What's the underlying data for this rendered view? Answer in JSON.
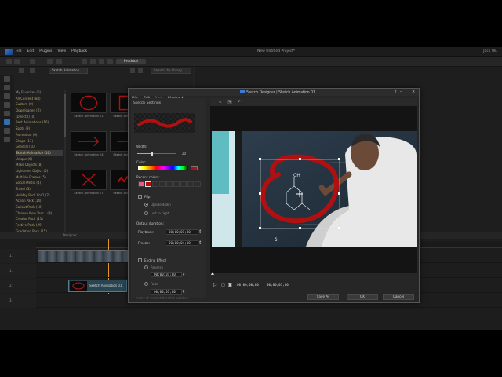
{
  "app": {
    "menu": [
      "File",
      "Edit",
      "Plugins",
      "View",
      "Playback"
    ],
    "project_title": "New Untitled Project*",
    "user": "Jack Wu",
    "produce_label": "Produce"
  },
  "library": {
    "dropdown_value": "Sketch Animation",
    "search_placeholder": "Search the library",
    "categories": [
      {
        "label": "My Favorites (0)",
        "type": "fav"
      },
      {
        "label": "All Content (84)"
      },
      {
        "label": "Custom (0)"
      },
      {
        "label": "Downloaded (0)"
      },
      {
        "label": "(DirectX) (0)"
      },
      {
        "label": "Best Animations (16)"
      },
      {
        "label": "Spots (9)"
      },
      {
        "label": "Animation (6)"
      },
      {
        "label": "Shape (17)"
      },
      {
        "label": "General (10)"
      },
      {
        "label": "Sketch Animation (16)",
        "type": "sel"
      },
      {
        "label": "Unique (6)"
      },
      {
        "label": "Make Objects (8)"
      },
      {
        "label": "Lightened Object (5)"
      },
      {
        "label": "Multiple Frames (5)"
      },
      {
        "label": "Social Media (4)"
      },
      {
        "label": "Travel (3)"
      },
      {
        "label": "Holiday Pack Vol 1 (7)"
      },
      {
        "label": "Action Pack (14)"
      },
      {
        "label": "Callout Pack (10)"
      },
      {
        "label": "Chinese New Year... (9)"
      },
      {
        "label": "Creator Pack (11)"
      },
      {
        "label": "Festive Pack (29)"
      },
      {
        "label": "Gradation Pack (15)"
      }
    ],
    "thumbnails": [
      {
        "label": "Sketch Animation 01",
        "shape": "circle"
      },
      {
        "label": "Sketch Animation 02",
        "shape": "square"
      },
      {
        "label": "Sketch Animation 03",
        "shape": "star"
      },
      {
        "label": "Sketch Animation 04",
        "shape": "arrow"
      },
      {
        "label": "Sketch Animation 05",
        "shape": "arrow"
      },
      {
        "label": "Sketch Animation 06",
        "shape": "x"
      },
      {
        "label": "Sketch Animation 07",
        "shape": "x"
      },
      {
        "label": "Sketch Animation 08",
        "shape": "brush"
      },
      {
        "label": "Sketch Animation 09",
        "shape": "brush"
      }
    ]
  },
  "timeline": {
    "tabs": [
      "Designer"
    ],
    "track_numbers": [
      "1.",
      "1.",
      "2.",
      "3."
    ],
    "fx_clip_label": "Sketch Animation 01"
  },
  "dialog": {
    "title": "Sketch Designer | Sketch Animation 01",
    "menu": [
      "File",
      "Edit",
      "Tools",
      "Playback"
    ],
    "settings_title": "Sketch Settings",
    "width_label": "Width:",
    "width_value": "20",
    "width_fraction": 0.35,
    "color_label": "Color:",
    "selected_color": "#b01010",
    "recent_label": "Recent colors:",
    "recent_colors": [
      "#f05a8a",
      "#b01010",
      "",
      "",
      "",
      "",
      "",
      "",
      ""
    ],
    "flip_label": "Flip",
    "upside_down_label": "Upside down",
    "left_right_label": "Left to right",
    "duration_label": "Output duration:",
    "playback_label": "Playback:",
    "playback_time": "00;00;01;00",
    "freeze_label": "Freeze:",
    "freeze_time": "00;00;04;00",
    "ending_label": "Ending Effect",
    "reverse_label": "Reverse",
    "reverse_time": "00;00;01;00",
    "fade_label": "Fade",
    "fade_time": "00;00;01;00",
    "bottom_note": "Insert at current timeline position",
    "current_time": "00;00;00;00",
    "total_time": "00;00;05;00",
    "save_as_label": "Save As",
    "ok_label": "OK",
    "cancel_label": "Cancel",
    "overlay_color": "#b01010"
  }
}
